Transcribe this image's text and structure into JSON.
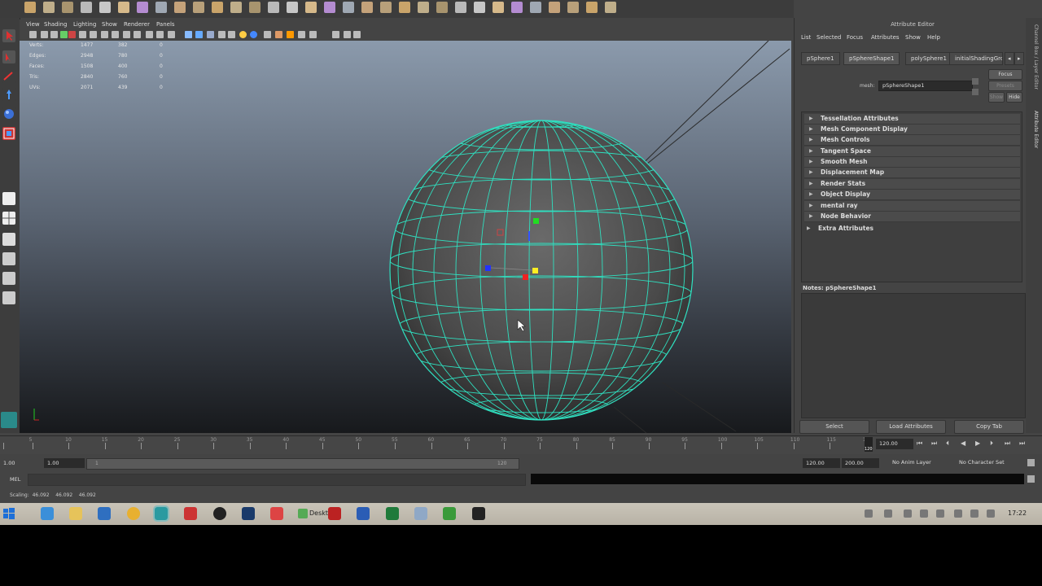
{
  "viewport": {
    "menu": [
      "View",
      "Shading",
      "Lighting",
      "Show",
      "Renderer",
      "Panels"
    ],
    "hud": [
      {
        "label": "Verts:",
        "v1": "1477",
        "v2": "382",
        "v3": "0"
      },
      {
        "label": "Edges:",
        "v1": "2948",
        "v2": "780",
        "v3": "0"
      },
      {
        "label": "Faces:",
        "v1": "1508",
        "v2": "400",
        "v3": "0"
      },
      {
        "label": "Tris:",
        "v1": "2840",
        "v2": "760",
        "v3": "0"
      },
      {
        "label": "UVs:",
        "v1": "2071",
        "v2": "439",
        "v3": "0"
      }
    ]
  },
  "attribute_editor": {
    "title": "Attribute Editor",
    "menu": [
      "List",
      "Selected",
      "Focus",
      "Attributes",
      "Show",
      "Help"
    ],
    "tabs": [
      "pSphere1",
      "pSphereShape1",
      "polySphere1",
      "initialShadingGroup"
    ],
    "mesh_label": "mesh:",
    "mesh_value": "pSphereShape1",
    "buttons": {
      "focus": "Focus",
      "presets": "Presets",
      "show": "Show",
      "hide": "Hide"
    },
    "sections": [
      "Tessellation Attributes",
      "Mesh Component Display",
      "Mesh Controls",
      "Tangent Space",
      "Smooth Mesh",
      "Displacement Map",
      "Render Stats",
      "Object Display",
      "mental ray",
      "Node Behavior",
      "Extra Attributes"
    ],
    "notes_label": "Notes:  pSphereShape1",
    "footer": {
      "select": "Select",
      "load": "Load Attributes",
      "copy": "Copy Tab"
    },
    "side_tabs": "Channel Box / Layer Editor",
    "side_tabs2": "Attribute Editor"
  },
  "timeline": {
    "ticks": [
      "5",
      "10",
      "15",
      "20",
      "25",
      "30",
      "35",
      "40",
      "45",
      "50",
      "55",
      "60",
      "65",
      "70",
      "75",
      "80",
      "85",
      "90",
      "95",
      "100",
      "105",
      "110",
      "115",
      "120"
    ],
    "current_frame_marker": "120",
    "current_time": "120.00"
  },
  "range": {
    "start": "1.00",
    "start2": "1.00",
    "slider_start": "1",
    "slider_end": "120",
    "end": "120.00",
    "end2": "200.00",
    "anim_layer": "No Anim Layer",
    "char_set": "No Character Set"
  },
  "cmdline": {
    "label": "MEL"
  },
  "helpline": {
    "text": "Scaling:  46.092    46.092    46.092"
  },
  "taskbar": {
    "items": [
      "start",
      "ie",
      "explorer",
      "outlook",
      "chrome",
      "maya",
      "acrobat",
      "unity",
      "photoshop",
      "adobe",
      "folder-desktop",
      "filezilla",
      "word",
      "excel",
      "network",
      "camtasia",
      "cmd"
    ],
    "desktop_label": "Deskt",
    "clock": "17:22"
  }
}
